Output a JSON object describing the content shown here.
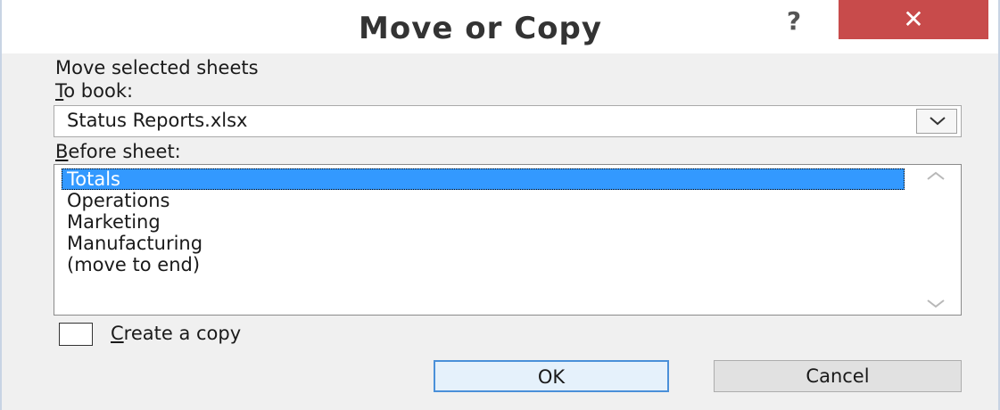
{
  "dialog": {
    "title": "Move or Copy",
    "help_glyph": "?",
    "close_glyph": "✕",
    "move_label": "Move selected sheets",
    "to_book": {
      "mnemonic": "T",
      "rest": "o book:",
      "value": "Status Reports.xlsx"
    },
    "before_sheet": {
      "mnemonic": "B",
      "rest": "efore sheet:",
      "items": [
        "Totals",
        "Operations",
        "Marketing",
        "Manufacturing",
        "(move to end)"
      ],
      "selected_index": 0
    },
    "create_copy": {
      "mnemonic": "C",
      "rest": "reate a copy",
      "checked": false
    },
    "ok_label": "OK",
    "cancel_label": "Cancel"
  },
  "colors": {
    "close_button": "#c84b4b",
    "selection": "#3399ff",
    "ok_border": "#4a90d9"
  },
  "icons": {
    "help": "question-mark-icon",
    "close": "close-icon",
    "dropdown": "chevron-down-icon",
    "scroll_up": "chevron-up-icon",
    "scroll_down": "chevron-down-icon"
  }
}
